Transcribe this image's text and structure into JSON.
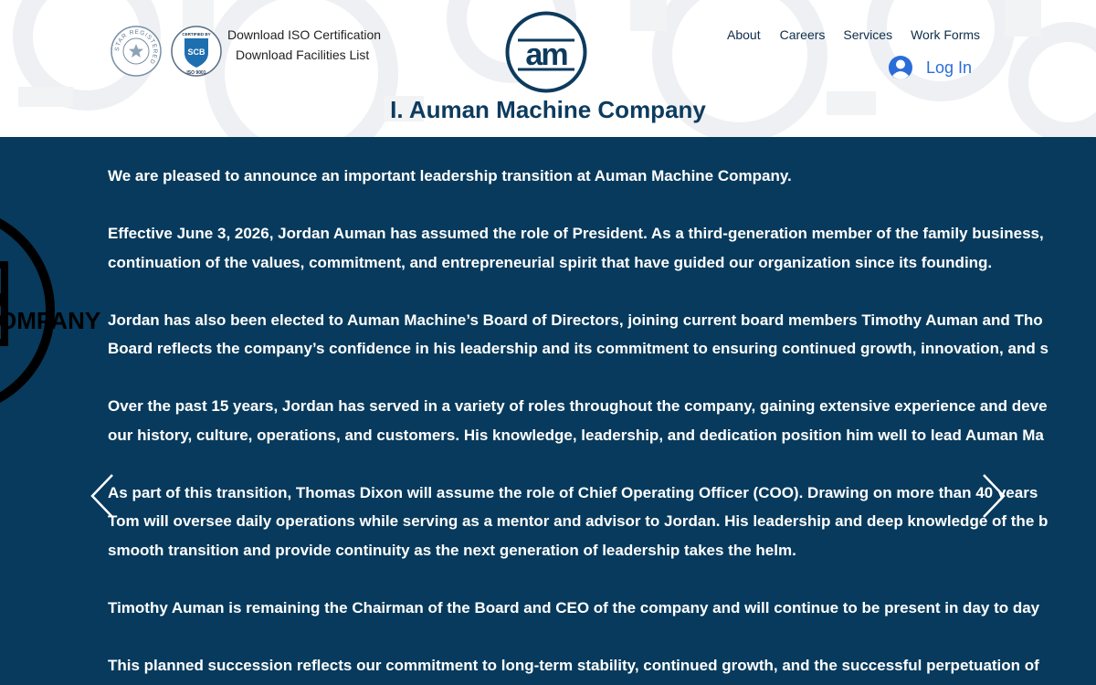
{
  "header": {
    "links": {
      "download_iso": "Download ISO Certification",
      "download_facilities": "Download Facilities List"
    },
    "badges": {
      "star_registered": {
        "ring_text": "STAR REGISTERED"
      },
      "scb": {
        "top_text": "CERTIFIED BY",
        "mark": "SCB",
        "bottom_text": "ISO 9001"
      }
    },
    "logo": {
      "mark": "am"
    },
    "nav": [
      {
        "label": "About"
      },
      {
        "label": "Careers"
      },
      {
        "label": "Services"
      },
      {
        "label": "Work Forms"
      }
    ],
    "login_label": "Log In",
    "company_title": "I. Auman Machine Company"
  },
  "main": {
    "background_color": "#073a5c",
    "watermark_text": "OMPANY",
    "paragraphs": [
      [
        "We are pleased to announce an important leadership transition at Auman Machine Company."
      ],
      [
        "Effective June 3, 2026, Jordan Auman has assumed the role of President. As a third-generation member of the family business,",
        "continuation of the values, commitment, and entrepreneurial spirit that have guided our organization since its founding."
      ],
      [
        "Jordan has also been elected to Auman Machine’s Board of Directors, joining current board members Timothy Auman and Tho",
        "Board reflects the company’s confidence in his leadership and its commitment to ensuring continued growth, innovation, and s"
      ],
      [
        "Over the past 15 years, Jordan has served in a variety of roles throughout the company, gaining extensive experience and deve",
        "our history, culture, operations, and customers. His knowledge, leadership, and dedication position him well to lead Auman Ma"
      ],
      [
        "As part of this transition, Thomas Dixon will assume the role of Chief Operating Officer (COO). Drawing on more than 40 years",
        "Tom will oversee daily operations while serving as a mentor and advisor to Jordan. His leadership and deep knowledge of the b",
        "smooth transition and provide continuity as the next generation of leadership takes the helm."
      ],
      [
        "Timothy Auman is remaining the Chairman of the Board and CEO of the company and will continue to be present in day to day"
      ],
      [
        "This planned succession reflects our commitment to long-term stability, continued growth, and the successful perpetuation of"
      ]
    ],
    "prev_icon": "chevron-left-icon",
    "next_icon": "chevron-right-icon"
  },
  "colors": {
    "title": "#0d3b5e",
    "nav": "#0e2d4a",
    "login": "#2b6cd9",
    "main_bg": "#073a5c",
    "text": "#ffffff"
  }
}
